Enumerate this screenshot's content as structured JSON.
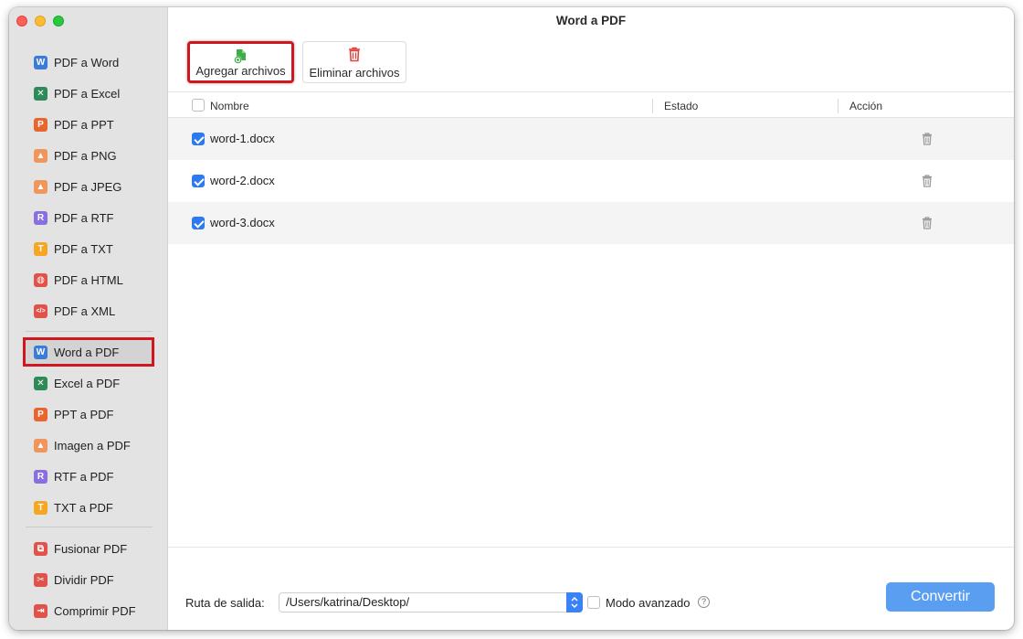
{
  "window": {
    "title": "Word a PDF"
  },
  "sidebar": {
    "group1": [
      {
        "label": "PDF a Word",
        "icon": "word-icon",
        "glyph": "W",
        "color": "#3b7bd9"
      },
      {
        "label": "PDF a Excel",
        "icon": "excel-icon",
        "glyph": "✕",
        "color": "#2e8b57"
      },
      {
        "label": "PDF a PPT",
        "icon": "ppt-icon",
        "glyph": "P",
        "color": "#e8662e"
      },
      {
        "label": "PDF a PNG",
        "icon": "image-icon",
        "glyph": "▲",
        "color": "#f0965a"
      },
      {
        "label": "PDF a JPEG",
        "icon": "image-icon",
        "glyph": "▲",
        "color": "#f0965a"
      },
      {
        "label": "PDF a RTF",
        "icon": "rtf-icon",
        "glyph": "R",
        "color": "#8a6fe0"
      },
      {
        "label": "PDF a TXT",
        "icon": "txt-icon",
        "glyph": "T",
        "color": "#f5a623"
      },
      {
        "label": "PDF a HTML",
        "icon": "globe-icon",
        "glyph": "◍",
        "color": "#e0524a"
      },
      {
        "label": "PDF a XML",
        "icon": "code-icon",
        "glyph": "</>",
        "color": "#e0524a"
      }
    ],
    "group2": [
      {
        "label": "Word a PDF",
        "icon": "word-icon",
        "glyph": "W",
        "color": "#3b7bd9"
      },
      {
        "label": "Excel a PDF",
        "icon": "excel-icon",
        "glyph": "✕",
        "color": "#2e8b57"
      },
      {
        "label": "PPT a PDF",
        "icon": "ppt-icon",
        "glyph": "P",
        "color": "#e8662e"
      },
      {
        "label": "Imagen a PDF",
        "icon": "image-icon",
        "glyph": "▲",
        "color": "#f0965a"
      },
      {
        "label": "RTF a PDF",
        "icon": "rtf-icon",
        "glyph": "R",
        "color": "#8a6fe0"
      },
      {
        "label": "TXT a PDF",
        "icon": "txt-icon",
        "glyph": "T",
        "color": "#f5a623"
      }
    ],
    "group3": [
      {
        "label": "Fusionar PDF",
        "icon": "merge-icon",
        "glyph": "⧉",
        "color": "#e0524a"
      },
      {
        "label": "Dividir PDF",
        "icon": "scissors-icon",
        "glyph": "✂",
        "color": "#e0524a"
      },
      {
        "label": "Comprimir PDF",
        "icon": "compress-icon",
        "glyph": "⇥",
        "color": "#e0524a"
      }
    ]
  },
  "toolbar": {
    "add_label": "Agregar archivos",
    "remove_label": "Eliminar archivos"
  },
  "table": {
    "columns": [
      "Nombre",
      "Estado",
      "Acción"
    ],
    "rows": [
      {
        "name": "word-1.docx",
        "checked": true
      },
      {
        "name": "word-2.docx",
        "checked": true
      },
      {
        "name": "word-3.docx",
        "checked": true
      }
    ]
  },
  "footer": {
    "output_label": "Ruta de salida:",
    "output_path": "/Users/katrina/Desktop/",
    "advanced_label": "Modo avanzado",
    "help_glyph": "?",
    "convert_label": "Convertir"
  },
  "colors": {
    "accent": "#2d79f0",
    "highlight": "#d0161e",
    "convert": "#5a9ef2"
  }
}
